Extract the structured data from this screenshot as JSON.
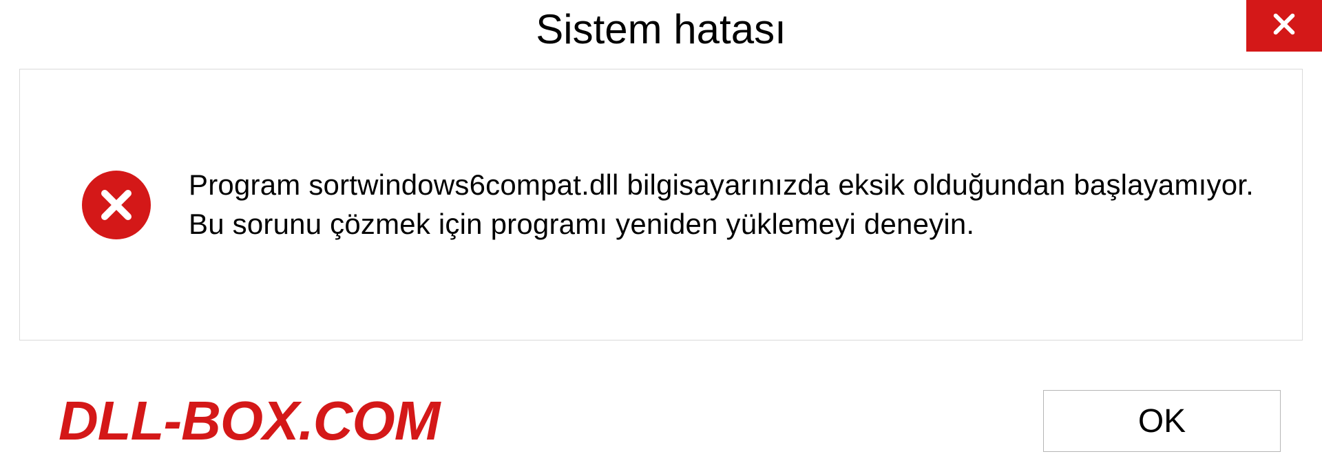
{
  "titlebar": {
    "title": "Sistem hatası"
  },
  "message": {
    "text": "Program sortwindows6compat.dll bilgisayarınızda eksik olduğundan başlayamıyor. Bu sorunu çözmek için programı yeniden yüklemeyi deneyin."
  },
  "footer": {
    "watermark": "DLL-BOX.COM",
    "ok_label": "OK"
  },
  "icons": {
    "close": "close-icon",
    "error": "error-icon"
  },
  "colors": {
    "accent_red": "#d41818",
    "border_gray": "#d9d9d9",
    "button_border": "#b5b5b5"
  }
}
